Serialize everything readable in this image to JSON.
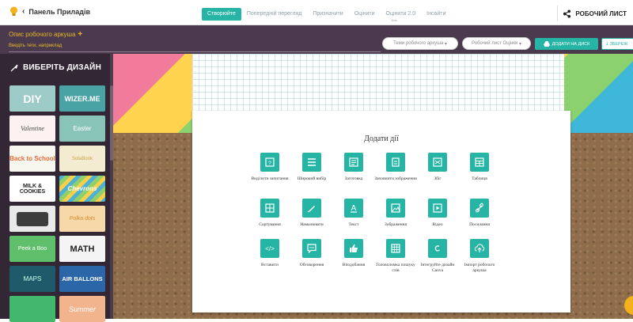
{
  "topbar": {
    "back_label": "Панель Приладів",
    "tabs": [
      {
        "label": "Створюйте",
        "active": true
      },
      {
        "label": "Попередній перегляд",
        "active": false
      },
      {
        "label": "Призначити",
        "active": false
      },
      {
        "label": "Оцінити",
        "active": false
      },
      {
        "label": "Оцінити 2.0",
        "sub": "Beta",
        "active": false
      },
      {
        "label": "Інсайти",
        "active": false
      }
    ],
    "worksheet_button": "РОБОЧИЙ ЛИСТ"
  },
  "header": {
    "description_label": "Опис робочого аркуша",
    "tags_placeholder": "Введіть теги, наприклад",
    "topics_dropdown": "Теми робочого аркуша",
    "grade_dropdown": "Робочий лист Оцінки",
    "drive_button": "ДОДАТИ НА ДИСК",
    "save_button": "ЗБЕРЕЖ"
  },
  "sidebar": {
    "title": "ВИБЕРІТЬ ДИЗАЙН",
    "designs": [
      "DIY",
      "WIZER.ME",
      "Valentine",
      "Easter",
      "Back to School",
      "SotaBook",
      "MILK & COOKIES",
      "Chevrons",
      "",
      "Polka dots",
      "Peek a Boo",
      "MATH",
      "MAPS",
      "AIR BALLONS",
      "",
      "Summer"
    ]
  },
  "panel": {
    "title": "Додати дії",
    "actions": [
      {
        "label": "Виділити запитання",
        "icon": "question-icon"
      },
      {
        "label": "Широкий вибір",
        "icon": "list-icon"
      },
      {
        "label": "Заготовка",
        "icon": "blank-text-icon"
      },
      {
        "label": "Заповнити зображення",
        "icon": "fill-image-icon"
      },
      {
        "label": "Збіг",
        "icon": "match-icon"
      },
      {
        "label": "Таблиця",
        "icon": "table-icon"
      },
      {
        "label": "Сортування",
        "icon": "sorting-icon"
      },
      {
        "label": "Намалювати",
        "icon": "pencil-icon"
      },
      {
        "label": "Текст",
        "icon": "text-icon"
      },
      {
        "label": "Зображення",
        "icon": "image-icon"
      },
      {
        "label": "Відео",
        "icon": "video-icon"
      },
      {
        "label": "Посилання",
        "icon": "link-icon"
      },
      {
        "label": "Вставити",
        "icon": "embed-code-icon"
      },
      {
        "label": "Обговорення",
        "icon": "discussion-icon"
      },
      {
        "label": "Вподобання",
        "icon": "thumbs-up-icon"
      },
      {
        "label": "Головоломка пошуку слів",
        "icon": "word-search-icon"
      },
      {
        "label": "Інтегруйте дизайн Canva",
        "icon": "canva-icon"
      },
      {
        "label": "Імпорт робочого аркуша",
        "icon": "upload-icon"
      }
    ]
  },
  "colors": {
    "accent": "#26b4a5",
    "header_bg": "#4b3a4e",
    "sidebar_bg": "#332735",
    "highlight": "#e9b826"
  }
}
